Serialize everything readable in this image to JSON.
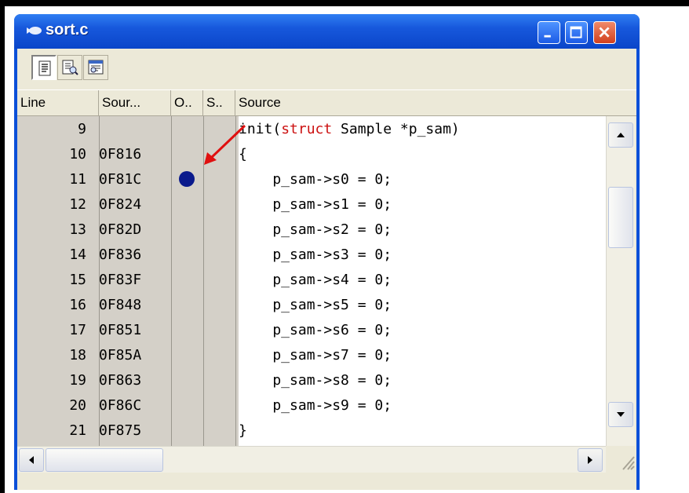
{
  "window": {
    "title": "sort.c"
  },
  "toolbar": {
    "buttons": [
      {
        "icon": "source-view-icon"
      },
      {
        "icon": "mixed-view-icon"
      },
      {
        "icon": "disassembly-view-icon"
      }
    ]
  },
  "columns": [
    "Line",
    "Sour...",
    "O..",
    "S..",
    "Source"
  ],
  "rows": [
    {
      "line": "9",
      "addr": "",
      "src_kw": "",
      "src": "init(",
      "src_kw2": "struct",
      "src_rest": " Sample *p_sam)"
    },
    {
      "line": "10",
      "addr": "0F816",
      "src": "{"
    },
    {
      "line": "11",
      "addr": "0F81C",
      "src": "    p_sam->s0 = 0;",
      "breakpoint": true
    },
    {
      "line": "12",
      "addr": "0F824",
      "src": "    p_sam->s1 = 0;"
    },
    {
      "line": "13",
      "addr": "0F82D",
      "src": "    p_sam->s2 = 0;"
    },
    {
      "line": "14",
      "addr": "0F836",
      "src": "    p_sam->s3 = 0;"
    },
    {
      "line": "15",
      "addr": "0F83F",
      "src": "    p_sam->s4 = 0;"
    },
    {
      "line": "16",
      "addr": "0F848",
      "src": "    p_sam->s5 = 0;"
    },
    {
      "line": "17",
      "addr": "0F851",
      "src": "    p_sam->s6 = 0;"
    },
    {
      "line": "18",
      "addr": "0F85A",
      "src": "    p_sam->s7 = 0;"
    },
    {
      "line": "19",
      "addr": "0F863",
      "src": "    p_sam->s8 = 0;"
    },
    {
      "line": "20",
      "addr": "0F86C",
      "src": "    p_sam->s9 = 0;"
    },
    {
      "line": "21",
      "addr": "0F875",
      "src": "}"
    }
  ],
  "colors": {
    "titlebar": "#0a45c9",
    "keyword": "#cc1111",
    "breakpoint": "#0a1a8c",
    "annotation_arrow": "#e01010"
  }
}
